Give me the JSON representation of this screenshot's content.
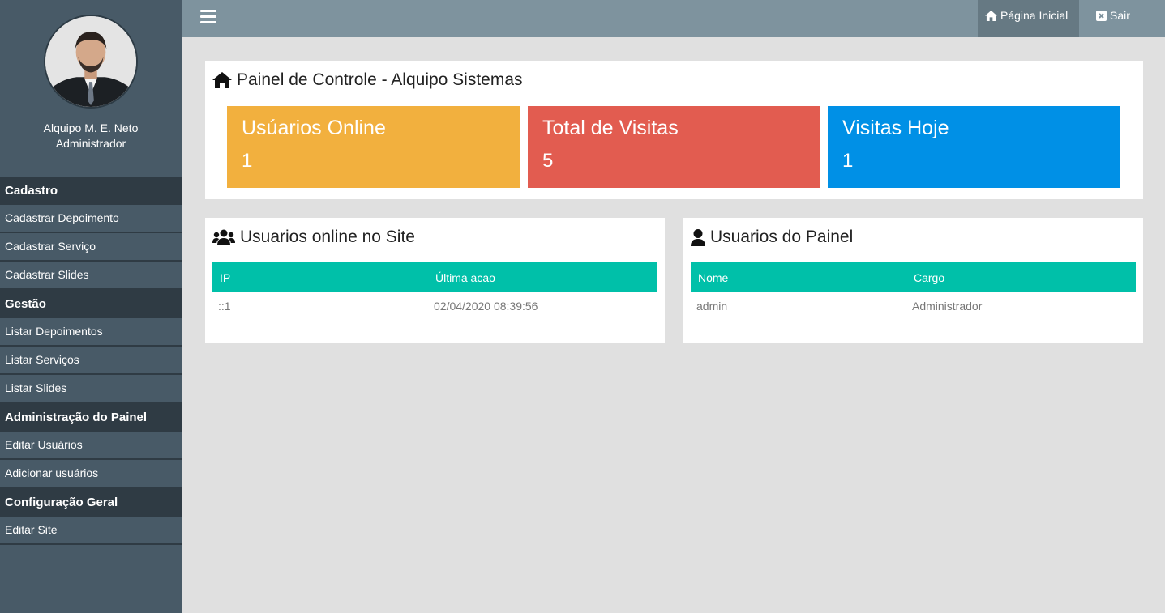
{
  "profile": {
    "name": "Alquipo M. E. Neto",
    "role": "Administrador"
  },
  "sidebar": {
    "sections": [
      {
        "title": "Cadastro",
        "items": [
          "Cadastrar Depoimento",
          "Cadastrar Serviço",
          "Cadastrar Slides"
        ]
      },
      {
        "title": "Gestão",
        "items": [
          "Listar Depoimentos",
          "Listar Serviços",
          "Listar Slides"
        ]
      },
      {
        "title": "Administração do Painel",
        "items": [
          "Editar Usuários",
          "Adicionar usuários"
        ]
      },
      {
        "title": "Configuração Geral",
        "items": [
          "Editar Site"
        ]
      }
    ]
  },
  "topbar": {
    "home_label": "Página Inicial",
    "exit_label": "Sair"
  },
  "dashboard": {
    "title": "Painel de Controle - Alquipo Sistemas",
    "cards": [
      {
        "label": "Usúarios Online",
        "value": "1",
        "color": "#f2b03e"
      },
      {
        "label": "Total de Visitas",
        "value": "5",
        "color": "#e25c50"
      },
      {
        "label": "Visitas Hoje",
        "value": "1",
        "color": "#0090e6"
      }
    ]
  },
  "online_panel": {
    "title": "Usuarios online no Site",
    "columns": [
      "IP",
      "Última acao"
    ],
    "rows": [
      [
        "::1",
        "02/04/2020 08:39:56"
      ]
    ]
  },
  "users_panel": {
    "title": "Usuarios do Painel",
    "columns": [
      "Nome",
      "Cargo"
    ],
    "rows": [
      [
        "admin",
        "Administrador"
      ]
    ]
  },
  "colors": {
    "sidebar": "#485a67",
    "sidebar_header": "#2f3b44",
    "topbar": "#7e939e",
    "table_header": "#00c0a9"
  }
}
